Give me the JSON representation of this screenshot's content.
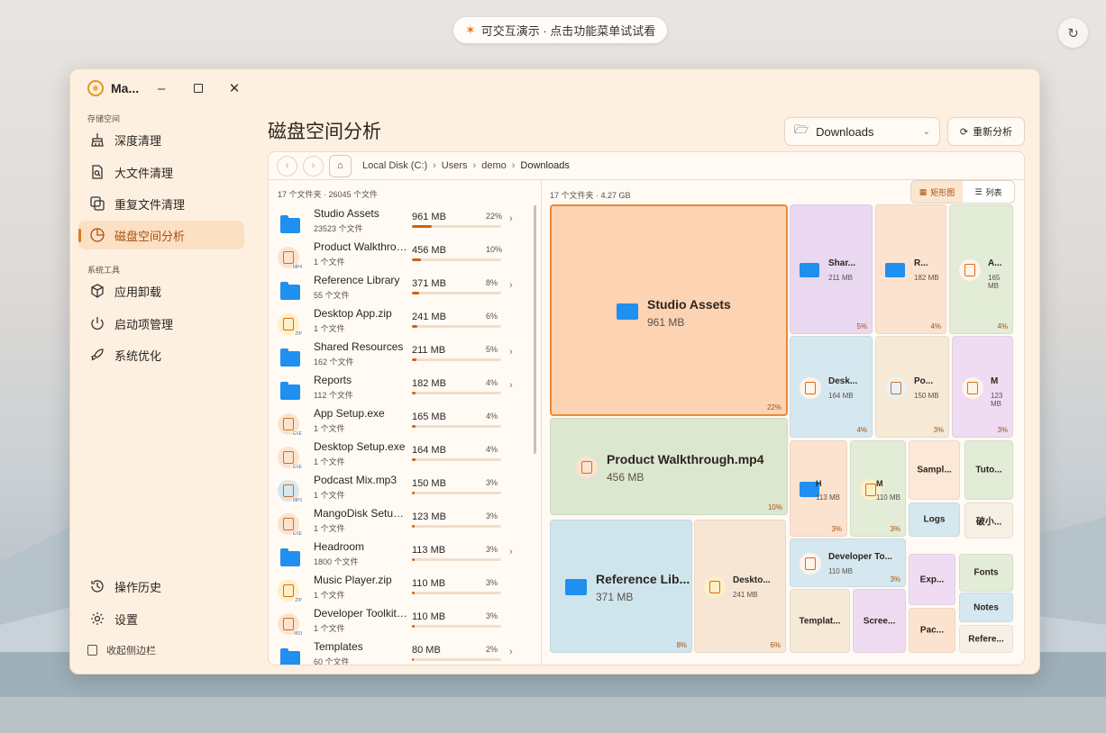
{
  "banner": {
    "text": "可交互演示 · 点击功能菜单试试看"
  },
  "window": {
    "app_name": "Ma..."
  },
  "sidebar": {
    "section_storage": "存储空间",
    "section_tools": "系统工具",
    "items": [
      {
        "label": "深度清理",
        "icon": "broom-icon"
      },
      {
        "label": "大文件清理",
        "icon": "large-file-icon"
      },
      {
        "label": "重复文件清理",
        "icon": "duplicate-icon"
      },
      {
        "label": "磁盘空间分析",
        "icon": "pie-icon",
        "active": true
      },
      {
        "label": "应用卸载",
        "icon": "package-icon"
      },
      {
        "label": "启动项管理",
        "icon": "power-icon"
      },
      {
        "label": "系统优化",
        "icon": "rocket-icon"
      }
    ],
    "history": "操作历史",
    "settings": "设置",
    "collapse": "收起侧边栏"
  },
  "main": {
    "title": "磁盘空间分析",
    "folder_select": "Downloads",
    "rescan": "重新分析",
    "breadcrumb": [
      "Local Disk (C:)",
      "Users",
      "demo",
      "Downloads"
    ],
    "list_summary": "17 个文件夹 · 26045 个文件",
    "treemap_summary": "17 个文件夹 · 4.27 GB",
    "view_treemap": "矩形图",
    "view_list": "列表"
  },
  "files": [
    {
      "name": "Studio Assets",
      "sub": "23523 个文件",
      "size": "961 MB",
      "pct": "22%",
      "fill": 0.22,
      "kind": "folder"
    },
    {
      "name": "Product Walkthrough.mp4",
      "sub": "1 个文件",
      "size": "456 MB",
      "pct": "10%",
      "fill": 0.1,
      "kind": "file",
      "ext": "MP4"
    },
    {
      "name": "Reference Library",
      "sub": "55 个文件",
      "size": "371 MB",
      "pct": "8%",
      "fill": 0.08,
      "kind": "folder"
    },
    {
      "name": "Desktop App.zip",
      "sub": "1 个文件",
      "size": "241 MB",
      "pct": "6%",
      "fill": 0.06,
      "kind": "file",
      "ext": "ZIP"
    },
    {
      "name": "Shared Resources",
      "sub": "162 个文件",
      "size": "211 MB",
      "pct": "5%",
      "fill": 0.05,
      "kind": "folder"
    },
    {
      "name": "Reports",
      "sub": "112 个文件",
      "size": "182 MB",
      "pct": "4%",
      "fill": 0.04,
      "kind": "folder"
    },
    {
      "name": "App Setup.exe",
      "sub": "1 个文件",
      "size": "165 MB",
      "pct": "4%",
      "fill": 0.04,
      "kind": "file",
      "ext": "EXE"
    },
    {
      "name": "Desktop Setup.exe",
      "sub": "1 个文件",
      "size": "164 MB",
      "pct": "4%",
      "fill": 0.04,
      "kind": "file",
      "ext": "EXE"
    },
    {
      "name": "Podcast Mix.mp3",
      "sub": "1 个文件",
      "size": "150 MB",
      "pct": "3%",
      "fill": 0.03,
      "kind": "file",
      "ext": "MP3"
    },
    {
      "name": "MangoDisk Setup.exe",
      "sub": "1 个文件",
      "size": "123 MB",
      "pct": "3%",
      "fill": 0.03,
      "kind": "file",
      "ext": "EXE"
    },
    {
      "name": "Headroom",
      "sub": "1800 个文件",
      "size": "113 MB",
      "pct": "3%",
      "fill": 0.03,
      "kind": "folder"
    },
    {
      "name": "Music Player.zip",
      "sub": "1 个文件",
      "size": "110 MB",
      "pct": "3%",
      "fill": 0.03,
      "kind": "file",
      "ext": "ZIP"
    },
    {
      "name": "Developer Toolkit.msi",
      "sub": "1 个文件",
      "size": "110 MB",
      "pct": "3%",
      "fill": 0.03,
      "kind": "file",
      "ext": "MSI"
    },
    {
      "name": "Templates",
      "sub": "60 个文件",
      "size": "80 MB",
      "pct": "2%",
      "fill": 0.02,
      "kind": "folder"
    }
  ],
  "treemap": [
    {
      "name": "Studio Assets",
      "size": "961 MB",
      "pct": "22%",
      "kind": "folder",
      "color": "#fcd3b3",
      "style": "big"
    },
    {
      "name": "Product Walkthrough.mp4",
      "size": "456 MB",
      "pct": "10%",
      "kind": "file",
      "ext": "MP4",
      "color": "#dbe7cf",
      "style": "big"
    },
    {
      "name": "Reference Lib...",
      "size": "371 MB",
      "pct": "8%",
      "kind": "folder",
      "color": "#cfe5ee",
      "style": "mid"
    },
    {
      "name": "Deskto...",
      "size": "241 MB",
      "pct": "6%",
      "kind": "file",
      "ext": "ZIP",
      "color": "#f6e6d3",
      "style": "small"
    },
    {
      "name": "Shar...",
      "size": "211 MB",
      "pct": "5%",
      "kind": "folder",
      "color": "#ead8f0",
      "style": "small"
    },
    {
      "name": "R...",
      "size": "182 MB",
      "pct": "4%",
      "kind": "folder",
      "color": "#fbe3cf",
      "style": "small"
    },
    {
      "name": "A...",
      "size": "165 MB",
      "pct": "4%",
      "kind": "file",
      "ext": "EXE",
      "color": "#e2ecd6",
      "style": "small"
    },
    {
      "name": "Desk...",
      "size": "164 MB",
      "pct": "4%",
      "kind": "file",
      "ext": "EXE",
      "color": "#d6e8ef",
      "style": "small"
    },
    {
      "name": "Po...",
      "size": "150 MB",
      "pct": "3%",
      "kind": "file",
      "ext": "MP3",
      "color": "#f6ead7",
      "style": "small"
    },
    {
      "name": "M",
      "size": "123 MB",
      "pct": "3%",
      "kind": "file",
      "ext": "EXE",
      "color": "#efdcf2",
      "style": "small"
    },
    {
      "name": "H",
      "size": "113 MB",
      "pct": "3%",
      "kind": "folder",
      "color": "#fbe3cf",
      "style": "tiny"
    },
    {
      "name": "M",
      "size": "110 MB",
      "pct": "3%",
      "kind": "file",
      "ext": "ZIP",
      "color": "#e2ecd6",
      "style": "tiny"
    },
    {
      "name": "Developer To...",
      "size": "110 MB",
      "pct": "3%",
      "kind": "file",
      "ext": "MSI",
      "color": "#d6e8ef",
      "style": "small"
    },
    {
      "name": "Sampl...",
      "color": "#fbe8d6",
      "style": "label"
    },
    {
      "name": "Tuto...",
      "color": "#e2ecd6",
      "style": "label"
    },
    {
      "name": "Logs",
      "color": "#d6e8ef",
      "style": "label"
    },
    {
      "name": "破小...",
      "color": "#f6efe4",
      "style": "label"
    },
    {
      "name": "Templat...",
      "color": "#f6ead7",
      "style": "label"
    },
    {
      "name": "Scree...",
      "color": "#efdcf2",
      "style": "label"
    },
    {
      "name": "Exp...",
      "color": "#efdcf2",
      "style": "label"
    },
    {
      "name": "Fonts",
      "color": "#e2ecd6",
      "style": "label"
    },
    {
      "name": "Notes",
      "color": "#d6e8ef",
      "style": "label"
    },
    {
      "name": "Pac...",
      "color": "#fbe3cf",
      "style": "label"
    },
    {
      "name": "Refere...",
      "color": "#f6efe4",
      "style": "label"
    }
  ]
}
